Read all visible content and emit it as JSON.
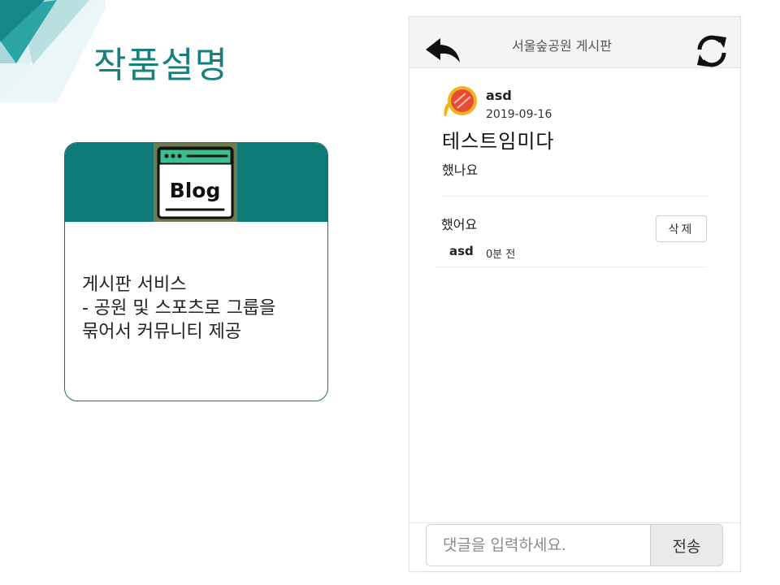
{
  "slide": {
    "title": "작품설명"
  },
  "card": {
    "icon_text": "Blog",
    "lines": [
      "게시판 서비스",
      "- 공원 및 스포츠로 그룹을",
      "묶어서 커뮤니티 제공"
    ]
  },
  "app": {
    "header": {
      "title": "서울숲공원 게시판",
      "back_icon": "back-arrow-icon",
      "refresh_icon": "refresh-icon"
    },
    "post": {
      "author": "asd",
      "date": "2019-09-16",
      "title": "테스트임미다",
      "body": "했나요"
    },
    "comments": [
      {
        "text": "했어요",
        "author": "asd",
        "time": "0분 전",
        "delete_label": "삭제"
      }
    ],
    "footer": {
      "input_placeholder": "댓글을 입력하세요.",
      "send_label": "전송"
    }
  },
  "colors": {
    "accent": "#0e7a78",
    "title": "#17807e"
  }
}
